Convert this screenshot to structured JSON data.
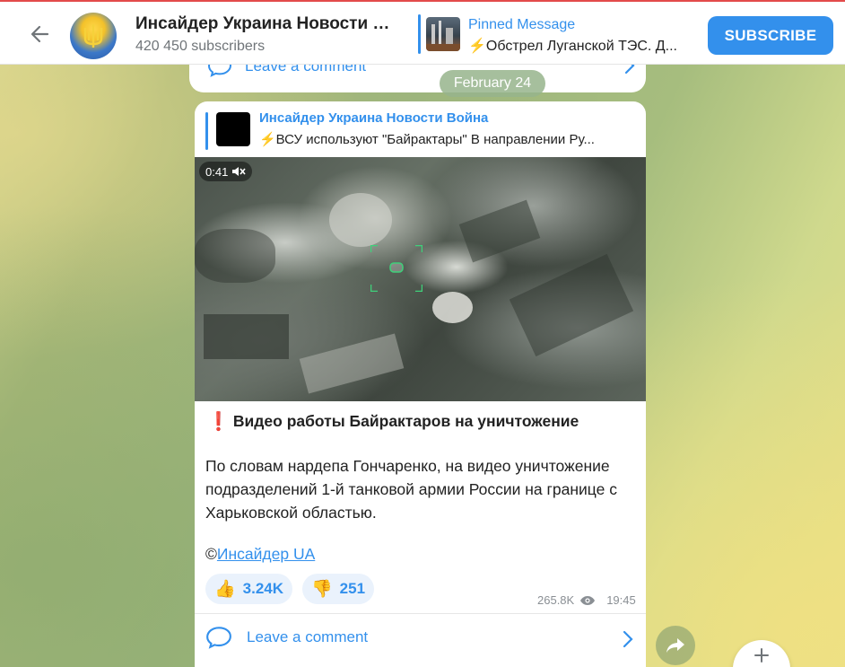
{
  "header": {
    "channel_title": "Инсайдер Украина Новости В...",
    "subscribers": "420 450 subscribers",
    "pinned_title": "Pinned Message",
    "pinned_text": "⚡Обстрел Луганской ТЭС. Д...",
    "subscribe_label": "SUBSCRIBE"
  },
  "prev_message": {
    "comment_label": "Leave a comment"
  },
  "date_separator": "February 24",
  "message": {
    "forward_title": "Инсайдер Украина Новости Война",
    "forward_text": "⚡ВСУ используют \"Байрактары\" В направлении Ру...",
    "video_duration": "0:41",
    "title_icon": "❗",
    "title": "Видео работы Байрактаров на уничтожение",
    "body": "По словам нардепа Гончаренко, на видео уничтожение  подразделений 1-й танковой армии России на границе с Харьковской областью.",
    "sign_prefix": "©",
    "sign_link": "Инсайдер UA",
    "reactions": [
      {
        "emoji": "👍",
        "count": "3.24K"
      },
      {
        "emoji": "👎",
        "count": "251"
      }
    ],
    "views": "265.8K",
    "time": "19:45",
    "comment_label": "Leave a comment"
  },
  "colors": {
    "accent": "#3390ec",
    "header_top_border": "#e34b4b"
  },
  "icons": [
    "back-arrow-icon",
    "comment-icon",
    "chevron-right-icon",
    "mute-icon",
    "eye-icon",
    "share-icon",
    "plus-icon"
  ]
}
